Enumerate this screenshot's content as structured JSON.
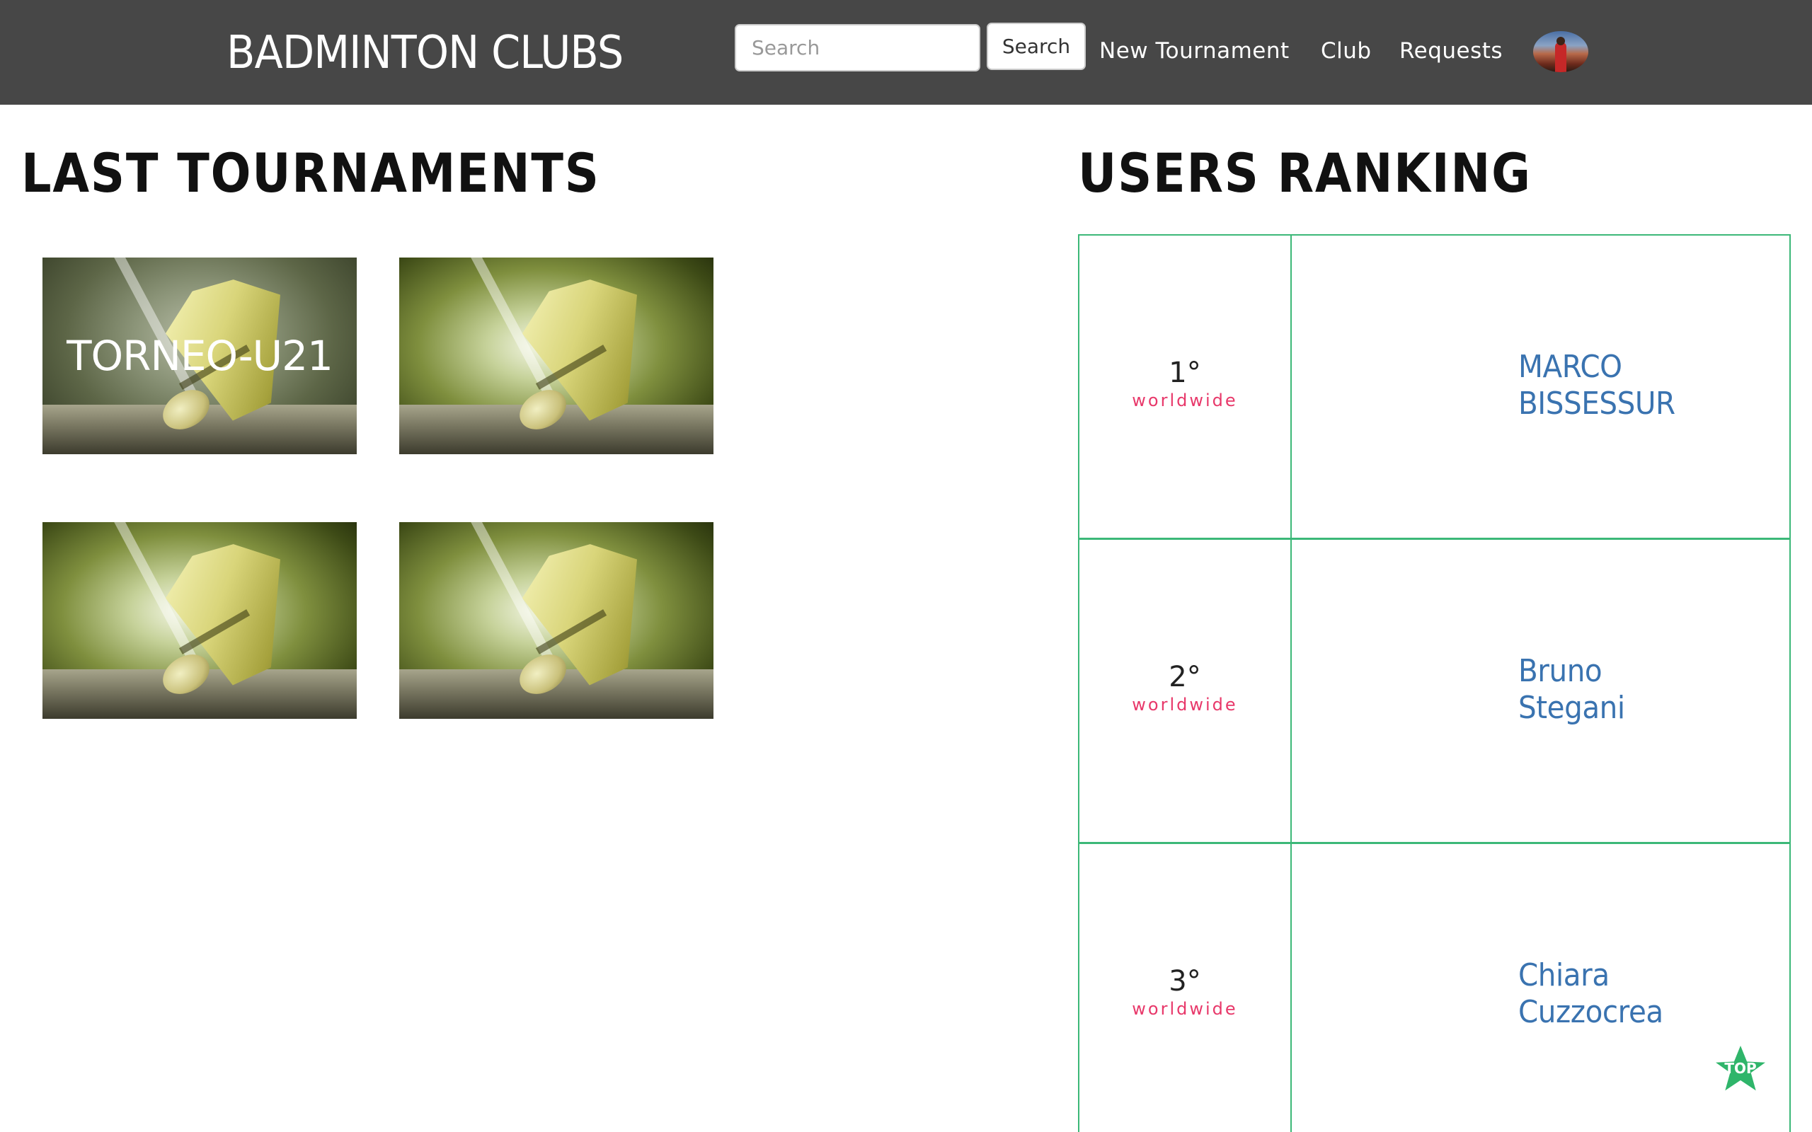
{
  "header": {
    "brand": "BADMINTON CLUBS",
    "search_placeholder": "Search",
    "search_button": "Search",
    "nav": [
      "New Tournament",
      "Club",
      "Requests"
    ]
  },
  "tournaments": {
    "title": "LAST TOURNAMENTS",
    "items": [
      {
        "label": "TORNEO-U21"
      },
      {
        "label": ""
      },
      {
        "label": ""
      },
      {
        "label": ""
      }
    ]
  },
  "ranking": {
    "title": "USERS RANKING",
    "rows": [
      {
        "position": "1°",
        "scope": "worldwide",
        "name_first": "MARCO",
        "name_last": "BISSESSUR"
      },
      {
        "position": "2°",
        "scope": "worldwide",
        "name_first": "Bruno",
        "name_last": "Stegani"
      },
      {
        "position": "3°",
        "scope": "worldwide",
        "name_first": "Chiara",
        "name_last": "Cuzzocrea"
      }
    ]
  },
  "top_button": "TOP",
  "colors": {
    "navbar": "#474747",
    "table_border": "#3cb878",
    "scope_text": "#e8386a",
    "name_link": "#3a73b0",
    "top_button": "#2fb56a"
  }
}
